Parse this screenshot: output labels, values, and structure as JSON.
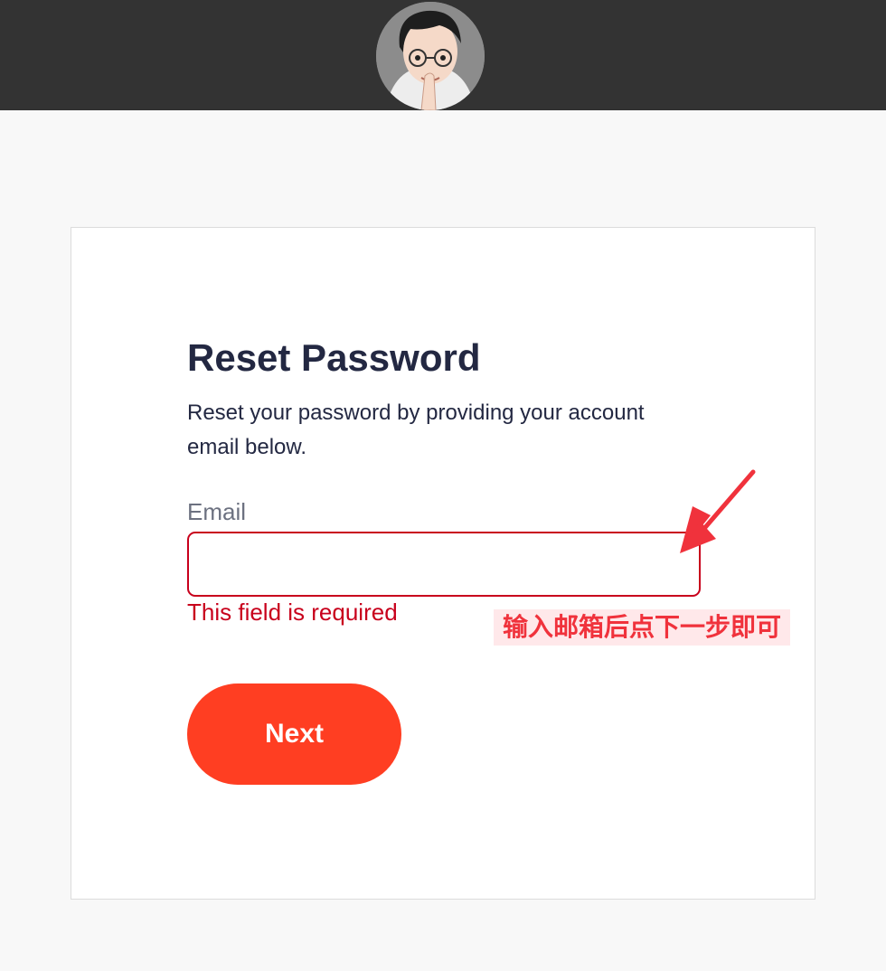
{
  "header": {
    "avatar_icon": "user-avatar-cartoon-icon"
  },
  "form": {
    "title": "Reset Password",
    "subtitle": "Reset your password by providing your account email below.",
    "email_label": "Email",
    "email_value": "",
    "email_placeholder": "",
    "error_message": "This field is required",
    "next_label": "Next"
  },
  "annotation": {
    "text": "输入邮箱后点下一步即可",
    "arrow_icon": "red-arrow-icon"
  },
  "colors": {
    "topbar": "#333333",
    "title": "#232842",
    "error": "#c8001c",
    "button": "#ff3e22",
    "annotation": "#f0323c"
  }
}
